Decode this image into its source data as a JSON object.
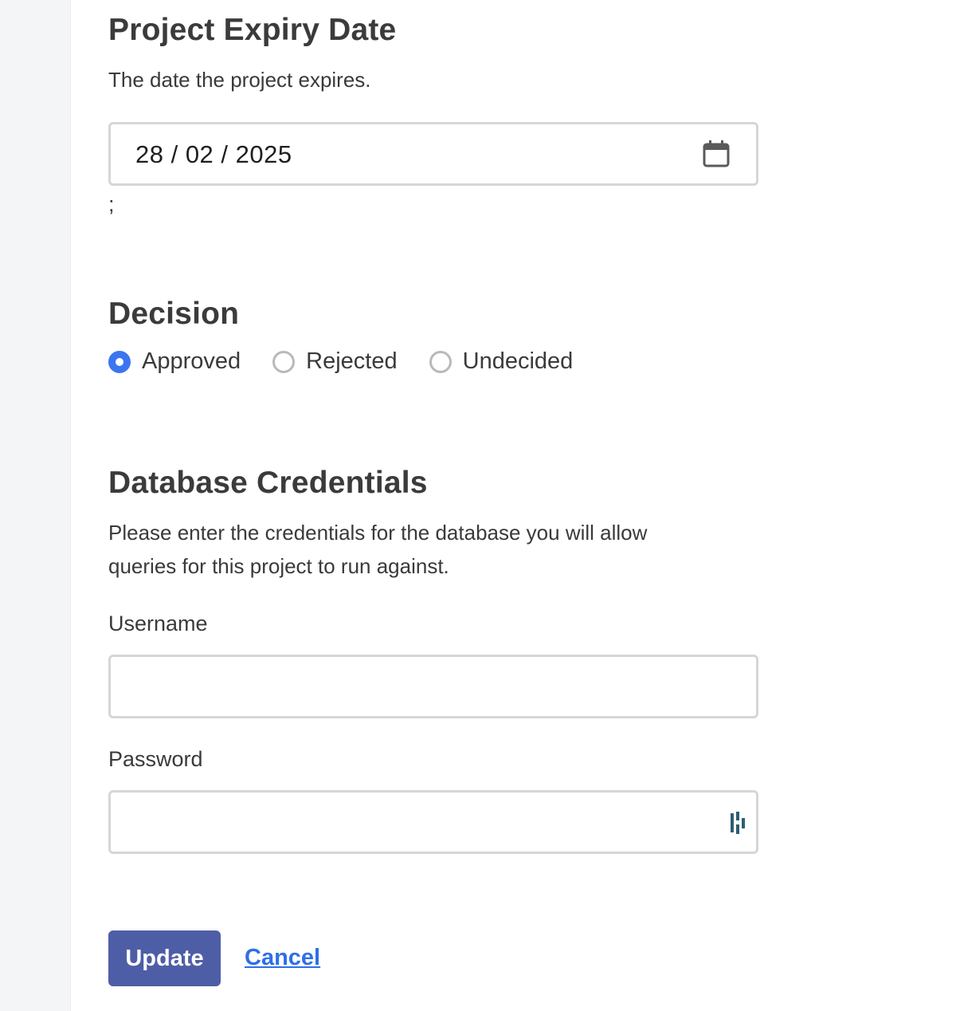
{
  "expiry": {
    "heading": "Project Expiry Date",
    "help": "The date the project expires.",
    "date_value": "28 / 02 / 2025",
    "trailing_text": ";"
  },
  "decision": {
    "heading": "Decision",
    "options": [
      {
        "label": "Approved",
        "selected": true
      },
      {
        "label": "Rejected",
        "selected": false
      },
      {
        "label": "Undecided",
        "selected": false
      }
    ]
  },
  "credentials": {
    "heading": "Database Credentials",
    "help": "Please enter the credentials for the database you will allow queries for this project to run against.",
    "username_label": "Username",
    "username_value": "",
    "password_label": "Password",
    "password_value": ""
  },
  "actions": {
    "update_label": "Update",
    "cancel_label": "Cancel"
  },
  "colors": {
    "primary_button": "#4e5ea6",
    "link": "#2f6fe8",
    "radio_selected": "#3b76f0"
  },
  "icons": {
    "date_picker": "calendar-icon",
    "password_manager": "password-manager-icon"
  }
}
